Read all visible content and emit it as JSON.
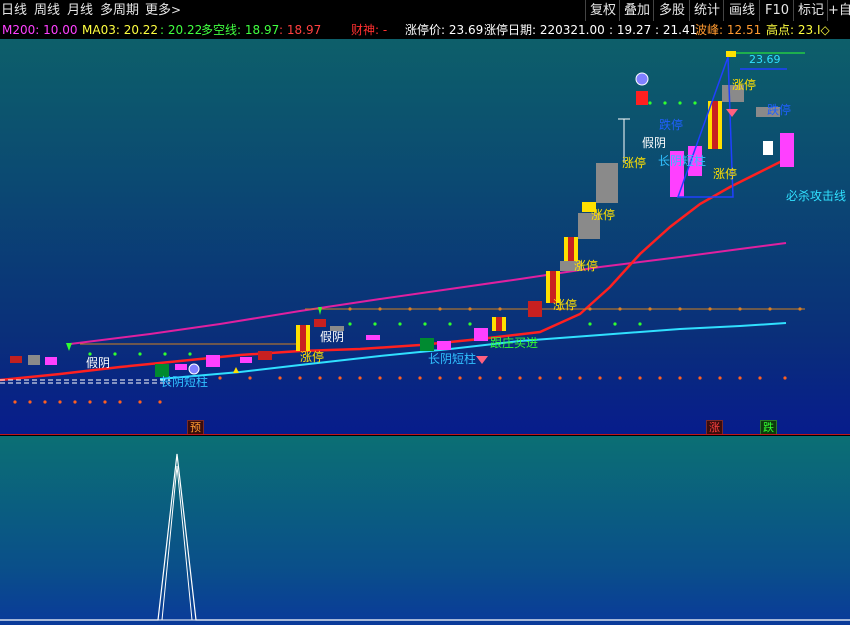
{
  "toolbar": {
    "tabs": [
      "日线",
      "周线",
      "月线",
      "多周期",
      "更多"
    ],
    "more_icon": "chevron-right-icon",
    "right_buttons": [
      "复权",
      "叠加",
      "多股",
      "统计",
      "画线",
      "F10",
      "标记",
      "+自"
    ]
  },
  "indicator_bar": {
    "m200": "M200: 10.00",
    "ma03": "MA03: 20.22",
    "v3": ": 20.22",
    "duokong": "多空线: 18.97",
    "v5": ": 18.97",
    "caishen": "财神: -",
    "zhangting_price": "涨停价: 23.69",
    "zhangting_date": "涨停日期: 220321.00",
    "v9": ": 19.27",
    "v10": ": 21.41",
    "bofeng": "波峰: 12.51",
    "gaodian": "高点: 23.I◇"
  },
  "colors": {
    "ma_red": "#ff2020",
    "ma_magenta": "#e020a0",
    "ma_cyan": "#30e0ff",
    "up_candle": "#ff40ff",
    "limit_up": "#ffe000",
    "down_gray": "#8a8a8a",
    "down_green": "#008a30"
  },
  "chart": {
    "price_high_label": "23.69",
    "annotations": {
      "jiayin_1": "假阴",
      "jiayin_2": "假阴",
      "jiayin_3": "假阴",
      "changyin_1": "长阴短柱",
      "changyin_2": "长阴短柱",
      "changyin_3": "长阴短柱",
      "zhangting": "涨停",
      "dieting": "跌停",
      "genzhuang": "跟庄买进",
      "bisha": "必杀攻击线"
    }
  },
  "signals": {
    "yu": "预",
    "zhang": "涨",
    "die": "跌"
  }
}
